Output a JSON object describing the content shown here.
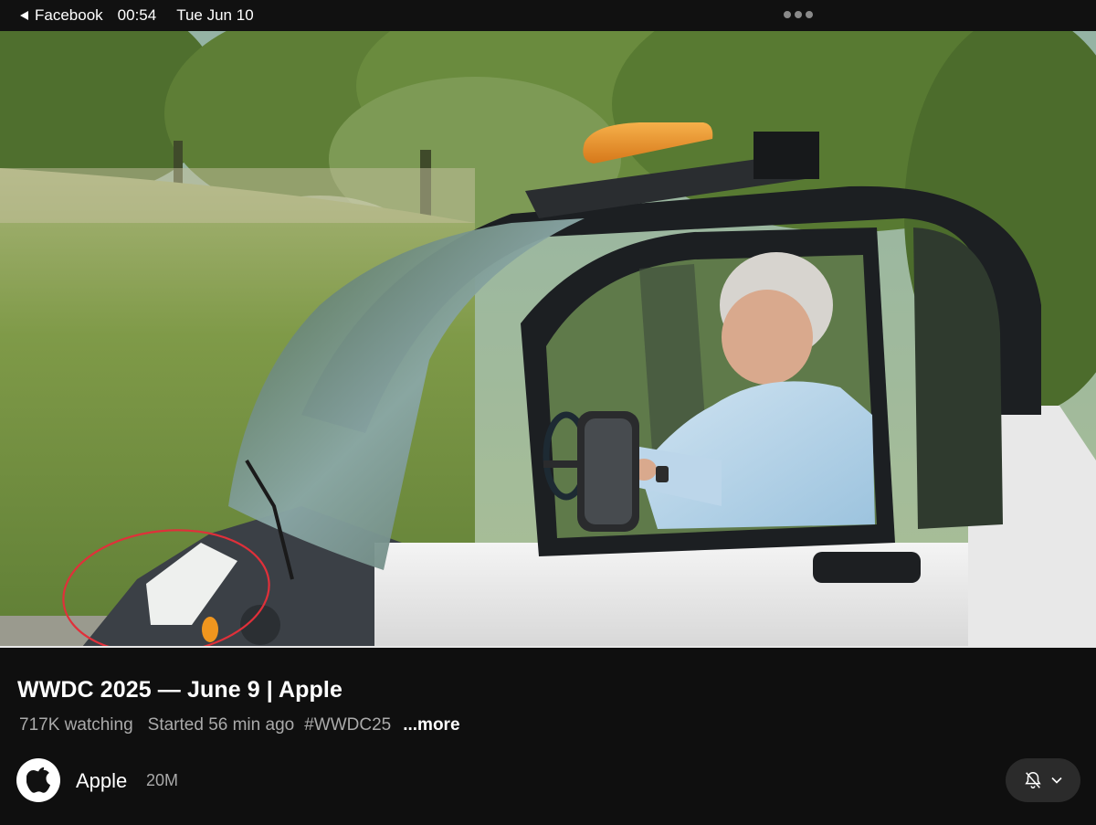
{
  "status_bar": {
    "back_app": "Facebook",
    "time": "00:54",
    "date": "Tue Jun 10",
    "more_icon": "ellipsis-icon"
  },
  "video": {
    "annotation": "red-circle-annotation",
    "progress_fraction": 1.0
  },
  "details": {
    "title": "WWDC 2025 — June 9 | Apple",
    "watching": "717K watching",
    "started": "Started 56 min ago",
    "hashtag": "#WWDC25",
    "more_label": "...more"
  },
  "channel": {
    "name": "Apple",
    "subscribers": "20M",
    "avatar_icon": "apple-logo-icon",
    "notify_icon": "bell-off-icon",
    "dropdown_icon": "chevron-down-icon"
  },
  "colors": {
    "background": "#0f0f0f",
    "annotation_red": "#e0303a",
    "beacon_orange": "#f0961e"
  }
}
